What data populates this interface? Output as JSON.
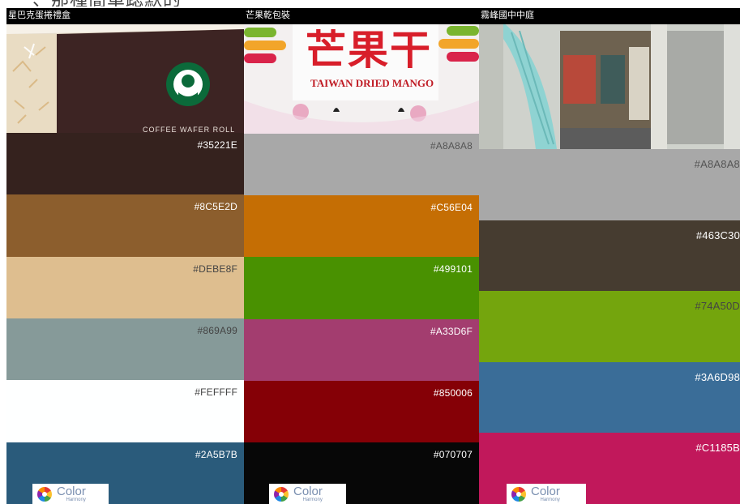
{
  "top_caption": "、那種簡單跽默的",
  "panels": [
    {
      "title": "星巴克蛋捲禮盒",
      "photo_text": "COFFEE WAFER ROLL",
      "swatches": [
        {
          "hex": "#35221E",
          "text_color": "#ffffff"
        },
        {
          "hex": "#8C5E2D",
          "text_color": "#ffffff"
        },
        {
          "hex": "#DEBE8F",
          "text_color": "#444444"
        },
        {
          "hex": "#869A99",
          "text_color": "#444444"
        },
        {
          "hex": "#FEFFFF",
          "text_color": "#444444"
        },
        {
          "hex": "#2A5B7B",
          "text_color": "#ffffff"
        }
      ],
      "logo": {
        "word": "Color",
        "sub": "Harmony"
      }
    },
    {
      "title": "芒果乾包裝",
      "photo_headline": "芒果干",
      "photo_text": "TAIWAN DRIED MANGO",
      "swatches": [
        {
          "hex": "#A8A8A8",
          "text_color": "#555555"
        },
        {
          "hex": "#C56E04",
          "text_color": "#ffffff"
        },
        {
          "hex": "#499101",
          "text_color": "#ffffff"
        },
        {
          "hex": "#A33D6F",
          "text_color": "#ffffff"
        },
        {
          "hex": "#850006",
          "text_color": "#ffffff"
        },
        {
          "hex": "#070707",
          "text_color": "#ffffff"
        }
      ],
      "logo": {
        "word": "Color",
        "sub": "Harmony"
      }
    },
    {
      "title": "霧峰國中中庭",
      "swatches": [
        {
          "hex": "#A8A8A8",
          "text_color": "#555555"
        },
        {
          "hex": "#463C30",
          "text_color": "#ffffff"
        },
        {
          "hex": "#74A50D",
          "text_color": "#444444"
        },
        {
          "hex": "#3A6D98",
          "text_color": "#ffffff"
        },
        {
          "hex": "#C1185B",
          "text_color": "#ffffff"
        }
      ],
      "logo": {
        "word": "Color",
        "sub": "Harmony"
      }
    }
  ]
}
